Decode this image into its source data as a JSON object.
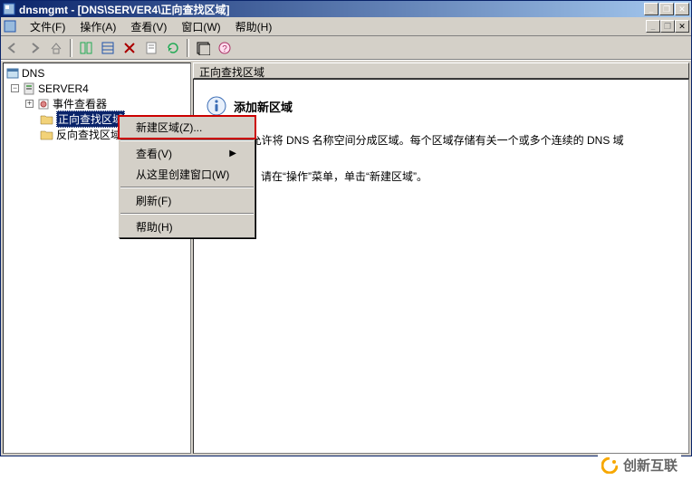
{
  "titlebar": {
    "text": "dnsmgmt - [DNS\\SERVER4\\正向查找区域]",
    "min": "_",
    "max": "❐",
    "close": "✕"
  },
  "menubar": {
    "file": "文件(F)",
    "action": "操作(A)",
    "view": "查看(V)",
    "window": "窗口(W)",
    "help": "帮助(H)",
    "endClose": "✕"
  },
  "toolbar": {
    "back": "←",
    "forward": "→",
    "up": "⇧",
    "b1": "▣",
    "b2": "▤",
    "b3": "☒",
    "b4": "✉",
    "b5": "☑",
    "b6": "❏",
    "b7": "?"
  },
  "tree": {
    "root": "DNS",
    "server": "SERVER4",
    "eventViewer": "事件查看器",
    "forwardZone": "正向查找区域",
    "reverseZone": "反向查找区域"
  },
  "detail": {
    "header": "正向查找区域",
    "title": "添加新区域",
    "p1": "域 (DNS)允许将 DNS 名称空间分成区域。每个区域存储有关一个或多个连续的 DNS 域",
    "p2": "个新区域，请在“操作”菜单，单击“新建区域”。"
  },
  "contextMenu": {
    "newZone": "新建区域(Z)...",
    "view": "查看(V)",
    "newWindow": "从这里创建窗口(W)",
    "refresh": "刷新(F)",
    "help": "帮助(H)"
  },
  "watermark": "创新互联"
}
